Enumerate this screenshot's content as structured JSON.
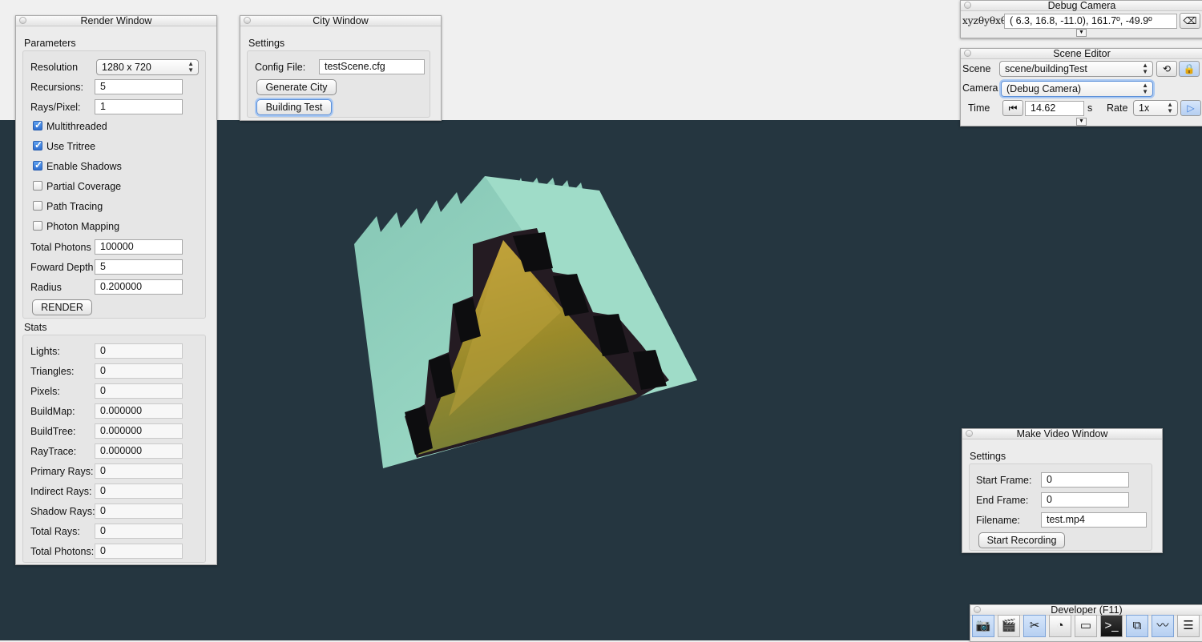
{
  "render_window": {
    "title": "Render Window",
    "parameters_label": "Parameters",
    "resolution_label": "Resolution",
    "resolution_value": "1280 x 720",
    "recursions_label": "Recursions:",
    "recursions_value": "5",
    "rays_label": "Rays/Pixel:",
    "rays_value": "1",
    "checkboxes": [
      {
        "label": "Multithreaded",
        "checked": true
      },
      {
        "label": "Use Tritree",
        "checked": true
      },
      {
        "label": "Enable Shadows",
        "checked": true
      },
      {
        "label": "Partial Coverage",
        "checked": false
      },
      {
        "label": "Path Tracing",
        "checked": false
      },
      {
        "label": "Photon Mapping",
        "checked": false
      }
    ],
    "total_photons_label": "Total Photons",
    "total_photons_value": "100000",
    "forward_depth_label": "Foward Depth",
    "forward_depth_value": "5",
    "radius_label": "Radius",
    "radius_value": "0.200000",
    "render_button": "RENDER",
    "stats_label": "Stats",
    "stats": [
      {
        "label": "Lights:",
        "value": "0"
      },
      {
        "label": "Triangles:",
        "value": "0"
      },
      {
        "label": "Pixels:",
        "value": "0"
      },
      {
        "label": "BuildMap:",
        "value": "0.000000"
      },
      {
        "label": "BuildTree:",
        "value": "0.000000"
      },
      {
        "label": "RayTrace:",
        "value": "0.000000"
      },
      {
        "label": "Primary Rays:",
        "value": "0"
      },
      {
        "label": "Indirect Rays:",
        "value": "0"
      },
      {
        "label": "Shadow Rays:",
        "value": "0"
      },
      {
        "label": "Total Rays:",
        "value": "0"
      },
      {
        "label": "Total Photons:",
        "value": "0"
      }
    ]
  },
  "city_window": {
    "title": "City Window",
    "settings_label": "Settings",
    "config_label": "Config File:",
    "config_value": "testScene.cfg",
    "generate_button": "Generate City",
    "building_test_button": "Building Test"
  },
  "debug_camera": {
    "title": "Debug Camera",
    "label": "xyzθyθxθz",
    "value": "(  6.3,  16.8, -11.0),  161.7º, -49.9º"
  },
  "scene_editor": {
    "title": "Scene Editor",
    "scene_label": "Scene",
    "scene_value": "scene/buildingTest",
    "camera_label": "Camera",
    "camera_value": "(Debug Camera)",
    "time_label": "Time",
    "time_value": "14.62",
    "time_unit": "s",
    "rate_label": "Rate",
    "rate_value": "1x"
  },
  "make_video": {
    "title": "Make Video Window",
    "settings_label": "Settings",
    "start_frame_label": "Start Frame:",
    "start_frame_value": "0",
    "end_frame_label": "End Frame:",
    "end_frame_value": "0",
    "filename_label": "Filename:",
    "filename_value": "test.mp4",
    "record_button": "Start Recording"
  },
  "developer": {
    "title": "Developer (F11)",
    "tools": [
      "camera-icon",
      "clapperboard-icon",
      "tools-icon",
      "clock-icon",
      "new-window-icon",
      "terminal-icon",
      "windows-icon",
      "activity-monitor-icon",
      "document-icon"
    ]
  },
  "colors": {
    "viewport": "#253640",
    "building_face": "#8fd3bd",
    "interior": "#b08a20"
  }
}
